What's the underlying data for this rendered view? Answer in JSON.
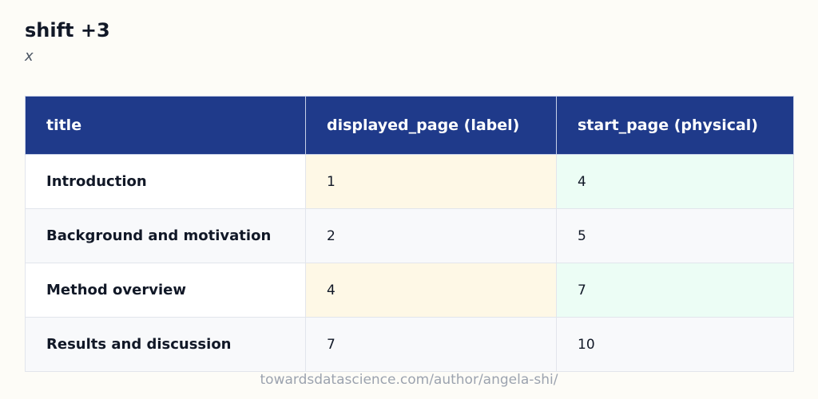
{
  "header": {
    "title": "shift +3",
    "subtitle": "x"
  },
  "table": {
    "columns": [
      "title",
      "displayed_page (label)",
      "start_page (physical)"
    ],
    "rows": [
      {
        "title": "Introduction",
        "displayed_page": "1",
        "start_page": "4"
      },
      {
        "title": "Background and motivation",
        "displayed_page": "2",
        "start_page": "5"
      },
      {
        "title": "Method overview",
        "displayed_page": "4",
        "start_page": "7"
      },
      {
        "title": "Results and discussion",
        "displayed_page": "7",
        "start_page": "10"
      }
    ]
  },
  "chart_data": {
    "type": "table",
    "title": "shift +3",
    "subtitle": "x",
    "columns": [
      "title",
      "displayed_page (label)",
      "start_page (physical)"
    ],
    "rows": [
      [
        "Introduction",
        1,
        4
      ],
      [
        "Background and motivation",
        2,
        5
      ],
      [
        "Method overview",
        4,
        7
      ],
      [
        "Results and discussion",
        7,
        10
      ]
    ]
  },
  "colors": {
    "header_bg": "#1f3a8a",
    "header_text": "#ffffff",
    "displayed_highlight": "#fef8e6",
    "start_highlight": "#ecfdf5",
    "page_bg": "#fdfcf7"
  },
  "footer": {
    "text": "towardsdatascience.com/author/angela-shi/"
  }
}
